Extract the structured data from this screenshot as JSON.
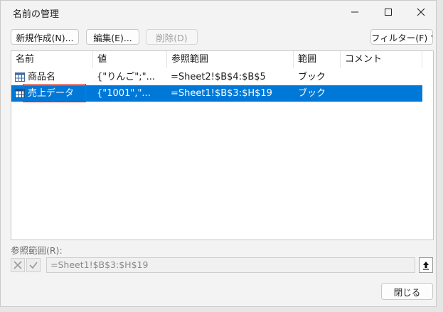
{
  "window": {
    "title": "名前の管理"
  },
  "toolbar": {
    "new_label": "新規作成(N)...",
    "edit_label": "編集(E)...",
    "delete_label": "削除(D)",
    "filter_label": "フィルター(F)"
  },
  "columns": [
    "名前",
    "値",
    "参照範囲",
    "範囲",
    "コメント"
  ],
  "rows": [
    {
      "name": "商品名",
      "value": "{\"りんご\";\"...",
      "refers_to": "=Sheet2!$B$4:$B$5",
      "scope": "ブック",
      "comment": "",
      "selected": false
    },
    {
      "name": "売上データ",
      "value": "{\"1001\",\"...",
      "refers_to": "=Sheet1!$B$3:$H$19",
      "scope": "ブック",
      "comment": "",
      "selected": true
    }
  ],
  "reference": {
    "label": "参照範囲(R):",
    "value": "=Sheet1!$B$3:$H$19"
  },
  "close_label": "閉じる",
  "colors": {
    "selection": "#0078d7",
    "highlight_box": "#d9352b"
  },
  "icons": [
    "table-grid-icon",
    "cancel-x-icon",
    "confirm-check-icon",
    "collapse-dialog-icon",
    "dropdown-arrow-icon",
    "minimize-icon",
    "maximize-icon",
    "close-icon"
  ]
}
